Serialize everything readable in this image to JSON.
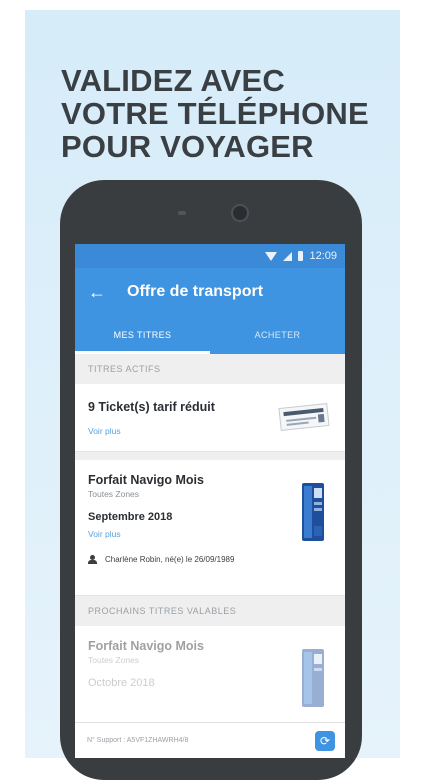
{
  "headline": {
    "line1": "VALIDEZ AVEC",
    "line2": "VOTRE TÉLÉPHONE",
    "line3": "POUR VOYAGER"
  },
  "status_bar": {
    "time": "12:09",
    "icons": [
      "wifi-icon",
      "signal-icon",
      "battery-icon"
    ]
  },
  "toolbar": {
    "back_icon": "arrow-left-icon",
    "title": "Offre de transport"
  },
  "tabs": [
    {
      "label": "MES TITRES",
      "active": true
    },
    {
      "label": "ACHETER",
      "active": false
    }
  ],
  "sections": {
    "active_header": "TITRES ACTIFS",
    "upcoming_header": "PROCHAINS TITRES VALABLES"
  },
  "cards": {
    "tickets": {
      "title": "9 Ticket(s) tarif réduit",
      "link": "Voir plus",
      "image_icon": "ticket-icon"
    },
    "navigo_month": {
      "title": "Forfait Navigo Mois",
      "zones": "Toutes Zones",
      "period": "Septembre 2018",
      "link": "Voir plus",
      "holder": "Charlène Robin, né(e) le 26/09/1989",
      "image_icon": "navigo-card-icon"
    },
    "navigo_next": {
      "title": "Forfait Navigo Mois",
      "zones": "Toutes Zones",
      "period": "Octobre 2018",
      "image_icon": "navigo-card-icon"
    }
  },
  "footer": {
    "support_text": "N° Support : A5VF1ZHAWRH4/8",
    "sync_icon": "sync-icon"
  },
  "colors": {
    "primary": "#3e94e1",
    "status_bar": "#3b8ad8",
    "background_promo": "#d6ecf9",
    "link": "#58a0e0"
  }
}
